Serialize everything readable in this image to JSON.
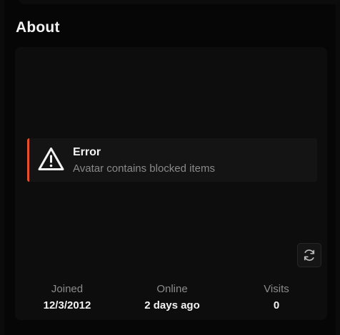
{
  "section": {
    "title": "About"
  },
  "error": {
    "title": "Error",
    "message": "Avatar contains blocked items",
    "accent_color": "#e4502c",
    "icon": "warning-icon"
  },
  "refresh": {
    "icon": "refresh-icon"
  },
  "stats": {
    "joined": {
      "label": "Joined",
      "value": "12/3/2012"
    },
    "online": {
      "label": "Online",
      "value": "2 days ago"
    },
    "visits": {
      "label": "Visits",
      "value": "0"
    }
  }
}
